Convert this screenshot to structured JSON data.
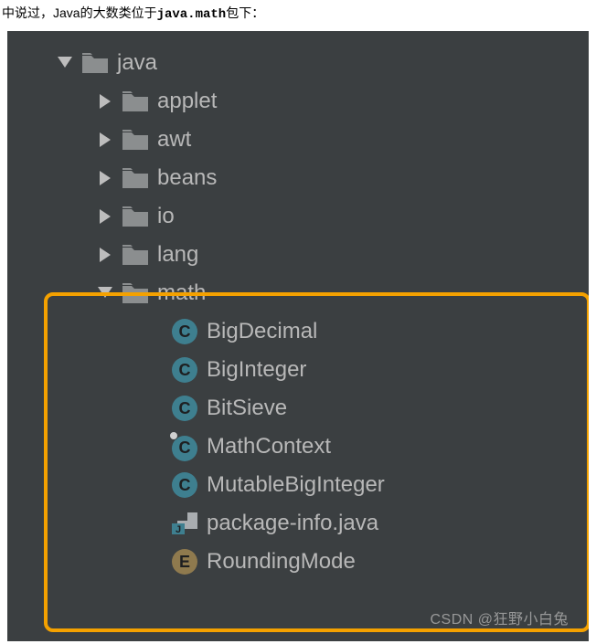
{
  "intro": {
    "prefix": "中说过，Java的大数类位于",
    "code": "java.math",
    "suffix": "包下："
  },
  "tree": {
    "root": {
      "label": "java",
      "expanded": true
    },
    "children": {
      "applet": {
        "label": "applet"
      },
      "awt": {
        "label": "awt"
      },
      "beans": {
        "label": "beans"
      },
      "io": {
        "label": "io"
      },
      "lang": {
        "label": "lang"
      },
      "math": {
        "label": "math",
        "expanded": true,
        "items": {
          "bigdecimal": {
            "label": "BigDecimal",
            "kind": "class"
          },
          "biginteger": {
            "label": "BigInteger",
            "kind": "class"
          },
          "bitsieve": {
            "label": "BitSieve",
            "kind": "class"
          },
          "mathcontext": {
            "label": "MathContext",
            "kind": "class",
            "final": true
          },
          "mutablebiginteger": {
            "label": "MutableBigInteger",
            "kind": "class"
          },
          "packageinfo": {
            "label": "package-info.java",
            "kind": "jfile"
          },
          "roundingmode": {
            "label": "RoundingMode",
            "kind": "enum"
          }
        }
      }
    }
  },
  "watermark": "CSDN @狂野小白兔"
}
